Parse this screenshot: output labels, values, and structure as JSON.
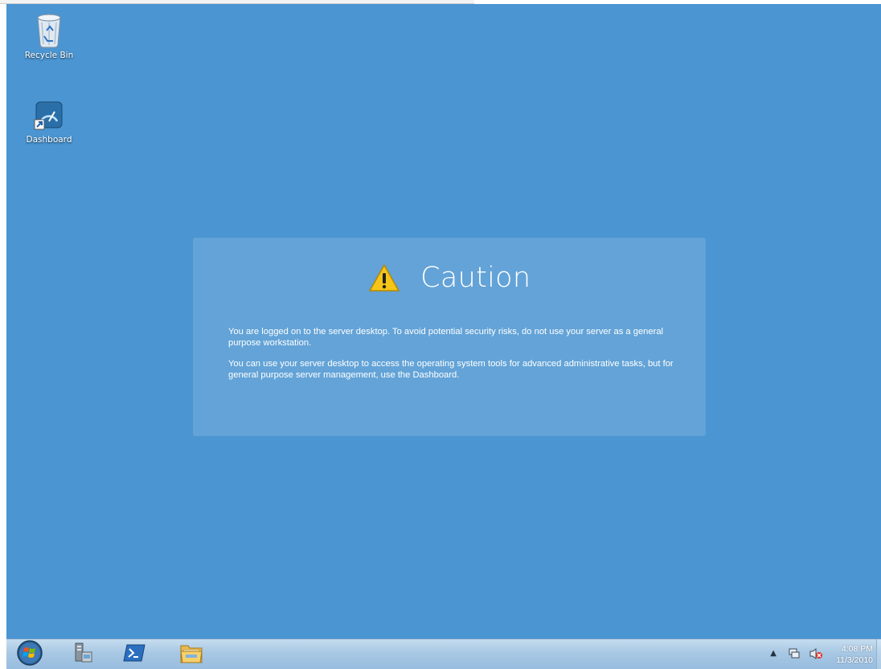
{
  "desktop": {
    "icons": [
      {
        "label": "Recycle Bin",
        "icon": "recycle-bin-icon"
      },
      {
        "label": "Dashboard",
        "icon": "dashboard-icon"
      }
    ]
  },
  "caution": {
    "title": "Caution",
    "icon": "warning-icon",
    "paragraph1": "You are logged on to the server desktop. To avoid potential security risks, do not use your server as a general purpose workstation.",
    "paragraph2": "You can use your server desktop to access the operating system tools for advanced administrative tasks, but for general purpose server management, use the Dashboard."
  },
  "taskbar": {
    "buttons": [
      "start-icon",
      "server-manager-icon",
      "powershell-icon",
      "file-explorer-icon"
    ],
    "tray": {
      "icons": [
        "show-hidden-icons-icon",
        "network-icon",
        "volume-muted-icon"
      ],
      "time": "4:08 PM",
      "date": "11/3/2010"
    }
  },
  "colors": {
    "desktop_bg": "#4a95d2",
    "caution_panel": "#82b4de",
    "taskbar": "#a8c8e4"
  }
}
